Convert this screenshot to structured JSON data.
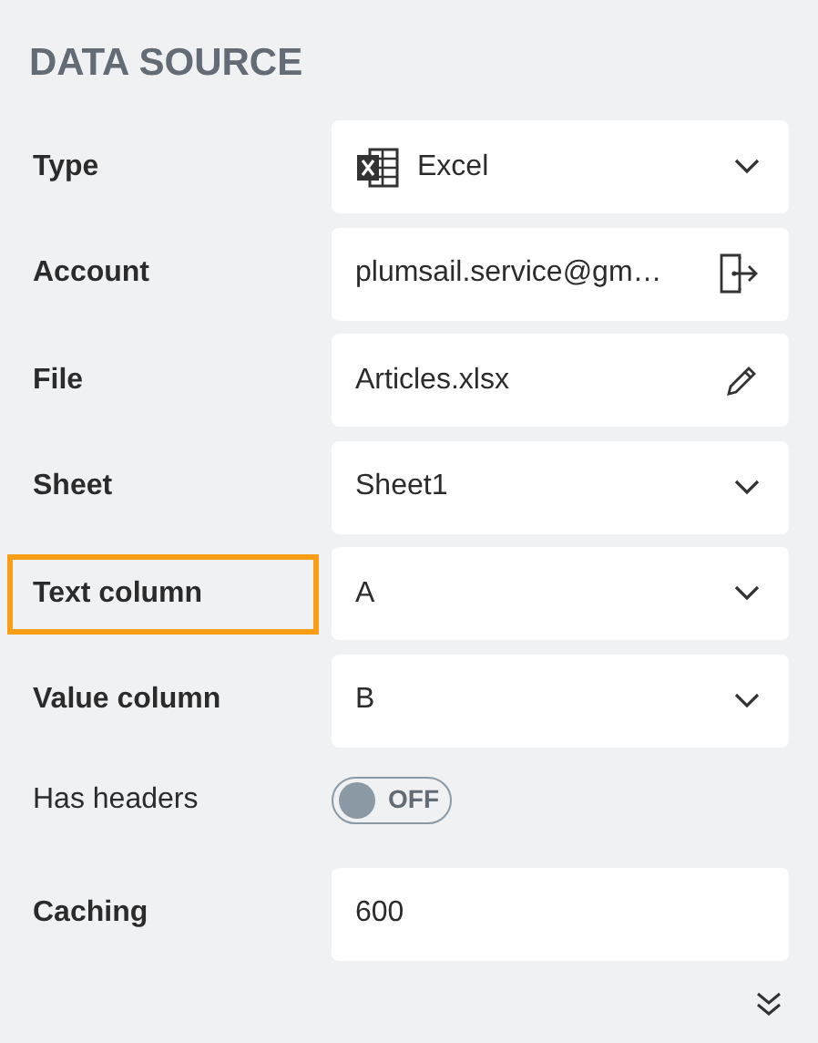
{
  "section_title": "DATA SOURCE",
  "fields": [
    {
      "label": "Type",
      "kind": "select",
      "value": "Excel",
      "highlighted": false
    },
    {
      "label": "Account",
      "kind": "action",
      "value": "plumsail.service@gm…",
      "highlighted": false
    },
    {
      "label": "File",
      "kind": "action",
      "value": "Articles.xlsx",
      "highlighted": false
    },
    {
      "label": "Sheet",
      "kind": "select",
      "value": "Sheet1",
      "highlighted": false
    },
    {
      "label": "Text column",
      "kind": "select",
      "value": "A",
      "highlighted": true
    },
    {
      "label": "Value column",
      "kind": "select",
      "value": "B",
      "highlighted": false
    },
    {
      "label": "Has headers",
      "kind": "toggle",
      "on": false,
      "state_text": "OFF",
      "highlighted": false
    },
    {
      "label": "Caching",
      "kind": "input",
      "value": "600",
      "highlighted": false
    }
  ]
}
